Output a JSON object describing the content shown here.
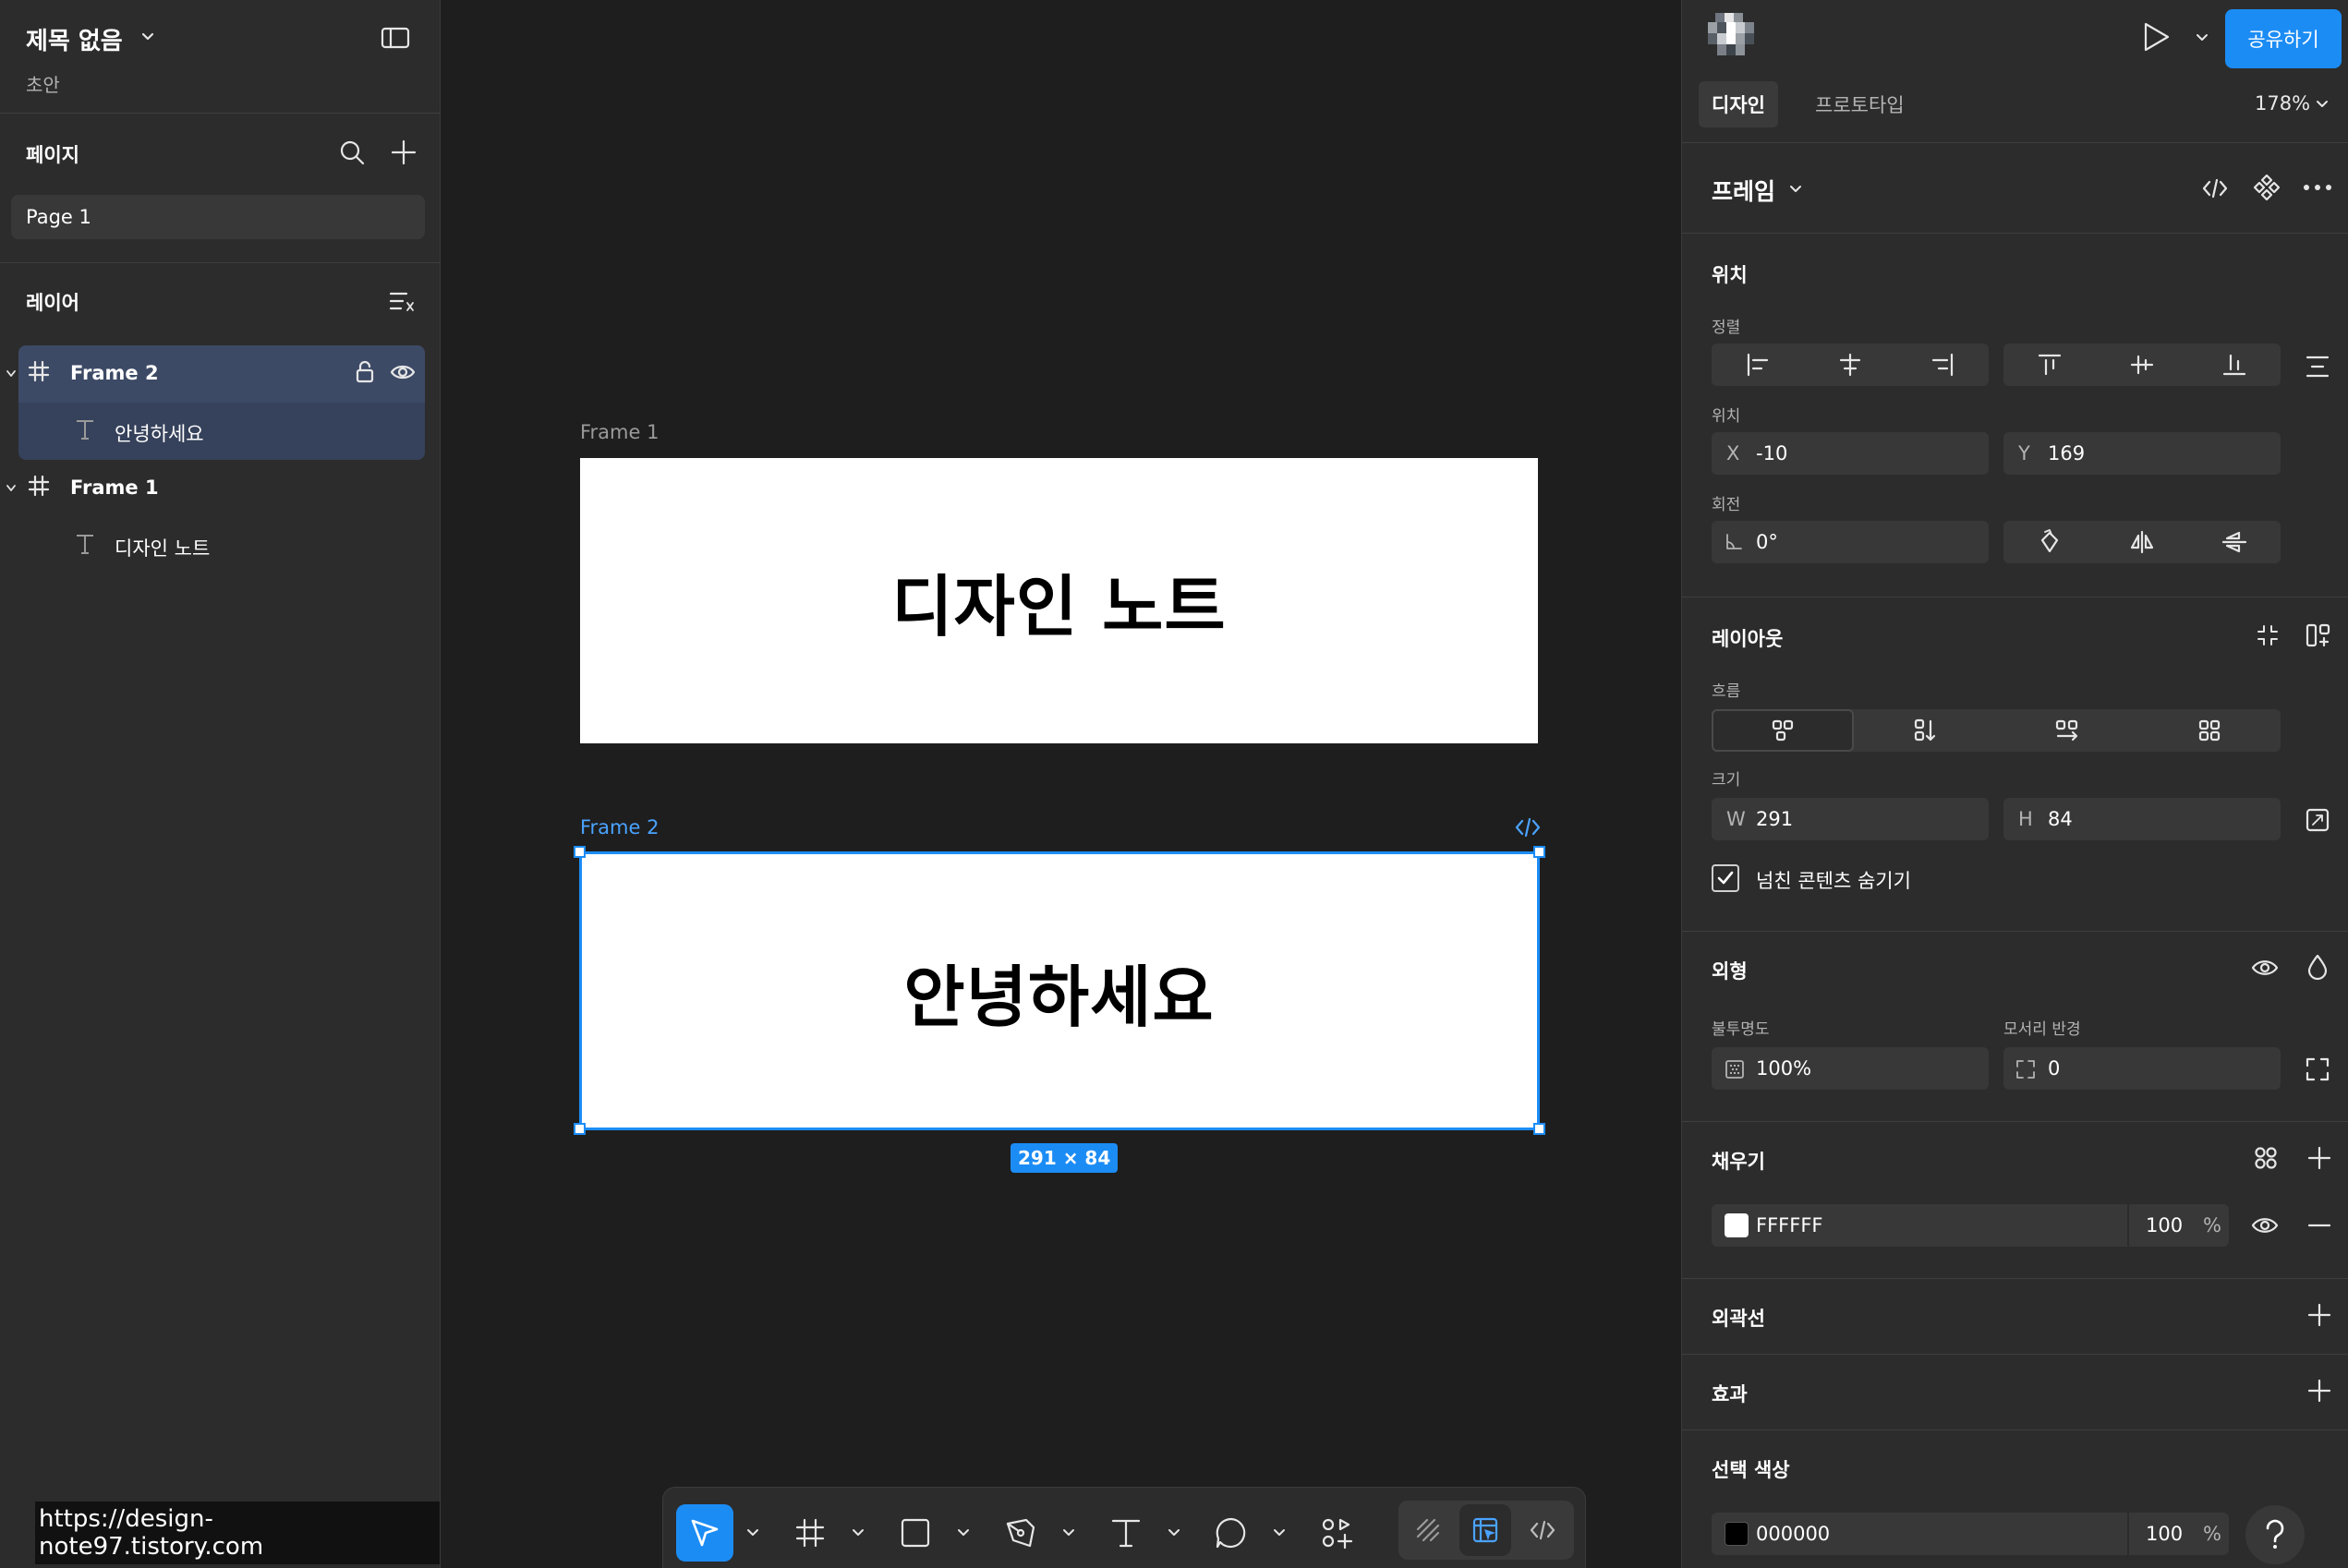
{
  "file": {
    "title": "제목 없음",
    "status": "초안"
  },
  "pages": {
    "title": "페이지",
    "items": [
      "Page 1"
    ]
  },
  "layers": {
    "title": "레이어",
    "items": [
      {
        "name": "Frame 2",
        "type": "frame",
        "selected": true
      },
      {
        "name": "안녕하세요",
        "type": "text",
        "selected": true
      },
      {
        "name": "Frame 1",
        "type": "frame",
        "selected": false
      },
      {
        "name": "디자인 노트",
        "type": "text",
        "selected": false
      }
    ]
  },
  "watermark": "https://design-note97.tistory.com",
  "canvas": {
    "frame1": {
      "label": "Frame 1",
      "text": "디자인 노트"
    },
    "frame2": {
      "label": "Frame 2",
      "text": "안녕하세요",
      "size_badge": "291 × 84"
    }
  },
  "header": {
    "share_label": "공유하기",
    "tabs": [
      "디자인",
      "프로토타입"
    ],
    "zoom": "178%"
  },
  "inspector": {
    "frame_title": "프레임",
    "position": {
      "title": "위치",
      "align_label": "정렬",
      "pos_label": "위치",
      "x_key": "X",
      "x": "-10",
      "y_key": "Y",
      "y": "169",
      "rotation_label": "회전",
      "rotation": "0°"
    },
    "layout": {
      "title": "레이아웃",
      "flow_label": "흐름",
      "size_label": "크기",
      "w_key": "W",
      "w": "291",
      "h_key": "H",
      "h": "84",
      "clip_label": "넘친 콘텐츠 숨기기",
      "clip_checked": true
    },
    "appearance": {
      "title": "외형",
      "opacity_label": "불투명도",
      "opacity": "100%",
      "radius_label": "모서리 반경",
      "radius": "0"
    },
    "fill": {
      "title": "채우기",
      "hex": "FFFFFF",
      "opacity": "100",
      "unit": "%",
      "color": "#FFFFFF"
    },
    "stroke": {
      "title": "외곽선"
    },
    "effects": {
      "title": "효과"
    },
    "selection_colors": {
      "title": "선택 색상",
      "hex": "000000",
      "opacity": "100",
      "unit": "%",
      "color": "#000000"
    }
  },
  "colors": {
    "accent": "#1C8CF5",
    "panel": "#2C2C2C",
    "canvas": "#1E1E1E"
  }
}
